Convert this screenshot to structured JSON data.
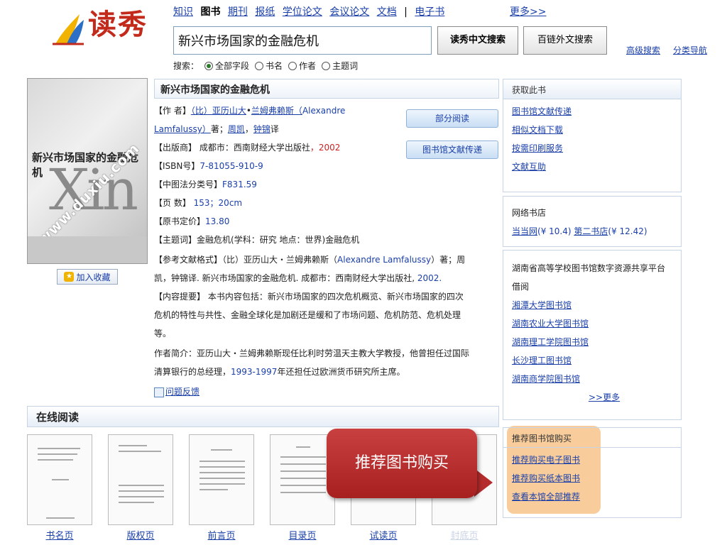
{
  "header": {
    "logo_text": "读秀",
    "nav": [
      "知识",
      "图书",
      "期刊",
      "报纸",
      "学位论文",
      "会议论文",
      "文档",
      "|",
      "电子书"
    ],
    "more": "更多>>",
    "search_value": "新兴市场国家的金融危机",
    "btn_cn_search": "读秀中文搜索",
    "btn_foreign_search": "百链外文搜索",
    "advanced": "高级搜索",
    "category_nav": "分类导航",
    "search_label": "搜索：",
    "search_options": [
      "全部字段",
      "书名",
      "作者",
      "主题词"
    ],
    "selected_option": "全部字段"
  },
  "cover": {
    "title_text": "新兴市场国家的金融危机",
    "watermark": "www.duxiu.com",
    "favorite": "加入收藏"
  },
  "book": {
    "title": "新兴市场国家的金融危机",
    "author_label": "【作 者】",
    "author_line1_a": "（比）亚历山大",
    "author_line1_b": "•",
    "author_line1_c": "兰姆弗赖斯（",
    "author_line1_d": "Alexandre",
    "author_line2_a": "Lamfalussy）",
    "author_line2_b": "著；",
    "author_line2_c": "周凯",
    "author_line2_d": "，",
    "author_line2_e": "钟锦",
    "author_line2_f": "译",
    "publisher_label": "【出版商】",
    "publisher": " 成都市：西南财经大学出版社",
    "year": "，2002",
    "isbn_label": "【ISBN号】",
    "isbn": "7-81055-910-9",
    "clc_label": "【中图法分类号】",
    "clc": "F831.59",
    "pages_label": "【页 数】",
    "pages": " 153；20cm",
    "price_label": "【原书定价】",
    "price": "13.80",
    "subject_label": "【主题词】",
    "subject": "金融危机(学科：研究 地点：世界)金融危机",
    "ref_label": "【参考文献格式】",
    "ref_line1": "（比）亚历山大・兰姆弗赖斯（",
    "ref_line1_b": "Alexandre Lamfalussy",
    "ref_line1_c": "）著；周",
    "ref_line2": "凯，钟锦译. 新兴市场国家的金融危机. 成都市：西南财经大学出版社,",
    "ref_year": " 2002.",
    "summary_label": "【内容提要】",
    "summary_line1": " 本书内容包括：新兴市场国家的四次危机概览、新兴市场国家的四次",
    "summary_line2": "危机的特性与共性、金融全球化是加剧还是缓和了市场问题、危机防范、危机处理",
    "summary_line3": "等。",
    "bio_line1": "作者简介：亚历山大・兰姆弗赖斯现任比利时劳温天主教大学教授，他曾担任过国际",
    "bio_line2_a": "清算银行的总经理，",
    "bio_line2_b": "1993-1997",
    "bio_line2_c": "年还担任过欧洲货币研究所主席。",
    "feedback": "问题反馈",
    "btn_partial": "部分阅读",
    "btn_delivery": "图书馆文献传递"
  },
  "right": {
    "get_head": "获取此书",
    "get_links": [
      "图书馆文献传递",
      "相似文档下载",
      "按需印刷服务",
      "文献互助"
    ],
    "store_head": "网络书店",
    "store_a": "当当网",
    "store_a_price": "(¥ 10.4)",
    "store_b": "第二书店",
    "store_b_price": "(¥ 12.42)",
    "lib_head_1": "湖南省高等学校图书馆数字资源共享平台",
    "lib_head_2": "借阅",
    "libs": [
      "湘潭大学图书馆",
      "湖南农业大学图书馆",
      "湖南理工学院图书馆",
      "长沙理工图书馆",
      "湖南商学院图书馆"
    ],
    "lib_more": ">>更多",
    "reco_head": "推荐图书馆购买",
    "reco_links": [
      "推荐购买电子图书",
      "推荐购买纸本图书",
      "查看本馆全部推荐"
    ]
  },
  "online": {
    "title": "在线阅读",
    "pages": [
      "书名页",
      "版权页",
      "前言页",
      "目录页",
      "试读页",
      "封底页"
    ]
  },
  "callout": {
    "text": "推荐图书购买"
  },
  "colors": {
    "link": "#1a3fa8",
    "logo_red": "#c22b1c",
    "callout_red": "#b52c2c",
    "highlight_orange": "#f7c48a"
  }
}
